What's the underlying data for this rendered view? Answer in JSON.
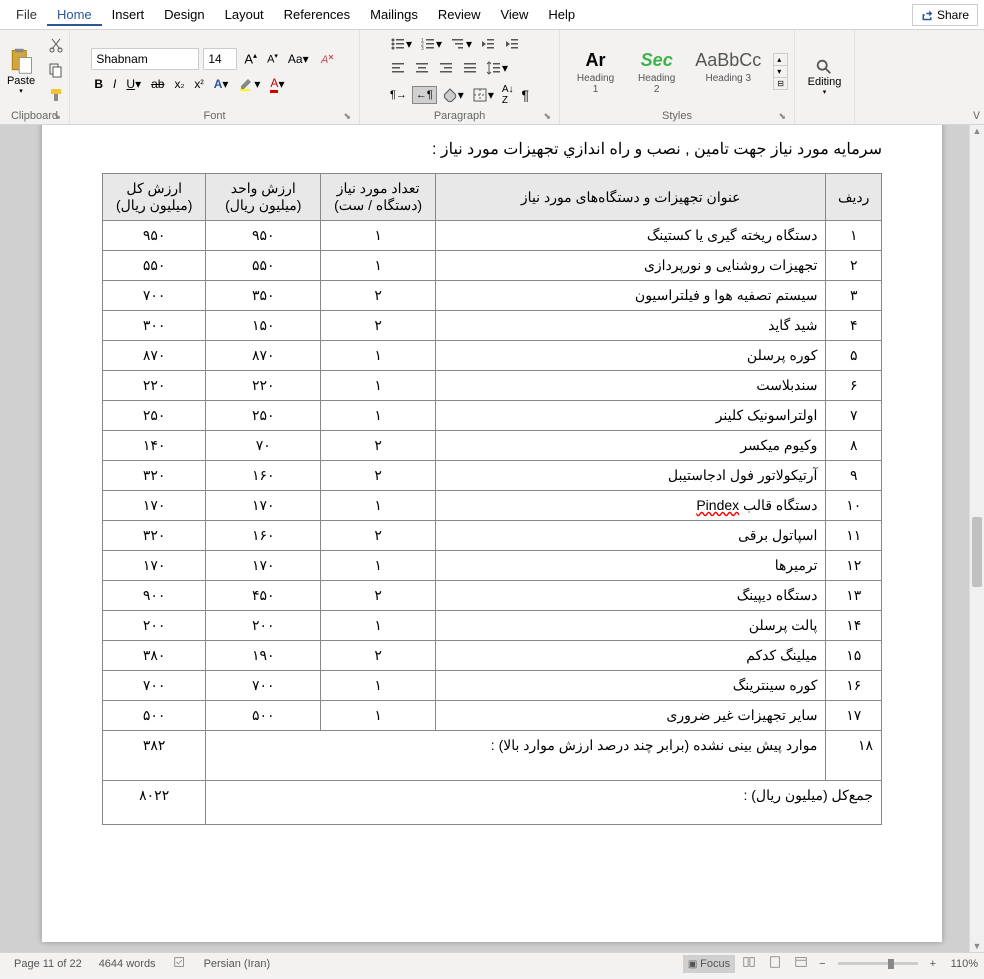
{
  "menu": {
    "file": "File",
    "home": "Home",
    "insert": "Insert",
    "design": "Design",
    "layout": "Layout",
    "references": "References",
    "mailings": "Mailings",
    "review": "Review",
    "view": "View",
    "help": "Help",
    "share": "Share"
  },
  "ribbon": {
    "clipboard": {
      "label": "Clipboard",
      "paste": "Paste"
    },
    "font": {
      "label": "Font",
      "name": "Shabnam",
      "size": "14"
    },
    "paragraph": {
      "label": "Paragraph"
    },
    "styles": {
      "label": "Styles",
      "items": [
        {
          "preview": "Ar",
          "label": "Heading 1",
          "color": "#000",
          "weight": "bold"
        },
        {
          "preview": "Sec",
          "label": "Heading 2",
          "color": "#3bb54a",
          "weight": "bold",
          "style": "italic"
        },
        {
          "preview": "AaBbCc",
          "label": "Heading 3",
          "color": "#555"
        }
      ]
    },
    "editing": {
      "label": "Editing"
    }
  },
  "document": {
    "title": "سرمایه مورد نیاز جهت تامین , نصب و راه اندازي تجهیزات مورد نیاز :",
    "headers": {
      "row": "ردیف",
      "item": "عنوان تجهیزات و دستگاه‌های مورد نیاز",
      "qty": "تعداد مورد نیاز (دستگاه / ست)",
      "unit": "ارزش واحد (میلیون ریال)",
      "total": "ارزش کل (میلیون ریال)"
    },
    "rows": [
      {
        "n": "۱",
        "item": "دستگاه ریخته گیری یا کستینگ",
        "qty": "۱",
        "unit": "۹۵۰",
        "total": "۹۵۰"
      },
      {
        "n": "۲",
        "item": "تجهیزات روشنایی و نورپردازی",
        "qty": "۱",
        "unit": "۵۵۰",
        "total": "۵۵۰"
      },
      {
        "n": "۳",
        "item": "سیستم تصفیه هوا و فیلتراسیون",
        "qty": "۲",
        "unit": "۳۵۰",
        "total": "۷۰۰"
      },
      {
        "n": "۴",
        "item": "شید گاید",
        "qty": "۲",
        "unit": "۱۵۰",
        "total": "۳۰۰"
      },
      {
        "n": "۵",
        "item": "کوره پرسلن",
        "qty": "۱",
        "unit": "۸۷۰",
        "total": "۸۷۰"
      },
      {
        "n": "۶",
        "item": "سندبلاست",
        "qty": "۱",
        "unit": "۲۲۰",
        "total": "۲۲۰"
      },
      {
        "n": "۷",
        "item": "اولتراسونیک کلینر",
        "qty": "۱",
        "unit": "۲۵۰",
        "total": "۲۵۰"
      },
      {
        "n": "۸",
        "item": "وکیوم میکسر",
        "qty": "۲",
        "unit": "۷۰",
        "total": "۱۴۰"
      },
      {
        "n": "۹",
        "item": "آرتیکولاتور فول ادجاستیبل",
        "qty": "۲",
        "unit": "۱۶۰",
        "total": "۳۲۰"
      },
      {
        "n": "۱۰",
        "item": "دستگاه قالب Pindex",
        "qty": "۱",
        "unit": "۱۷۰",
        "total": "۱۷۰"
      },
      {
        "n": "۱۱",
        "item": "اسپاتول برقی",
        "qty": "۲",
        "unit": "۱۶۰",
        "total": "۳۲۰"
      },
      {
        "n": "۱۲",
        "item": "ترمیرها",
        "qty": "۱",
        "unit": "۱۷۰",
        "total": "۱۷۰"
      },
      {
        "n": "۱۳",
        "item": "دستگاه دیپینگ",
        "qty": "۲",
        "unit": "۴۵۰",
        "total": "۹۰۰"
      },
      {
        "n": "۱۴",
        "item": "پالت پرسلن",
        "qty": "۱",
        "unit": "۲۰۰",
        "total": "۲۰۰"
      },
      {
        "n": "۱۵",
        "item": "میلینگ کدکم",
        "qty": "۲",
        "unit": "۱۹۰",
        "total": "۳۸۰"
      },
      {
        "n": "۱۶",
        "item": "کوره سینترینگ",
        "qty": "۱",
        "unit": "۷۰۰",
        "total": "۷۰۰"
      },
      {
        "n": "۱۷",
        "item": "سایر تجهیزات غیر ضروری",
        "qty": "۱",
        "unit": "۵۰۰",
        "total": "۵۰۰"
      }
    ],
    "footer_row": {
      "n": "۱۸",
      "text": "موارد پیش بینی نشده (برابر چند درصد ارزش موارد بالا) :",
      "total": "۳۸۲"
    },
    "sum_row": {
      "text": "جمع‌کل (میلیون ریال) :",
      "total": "۸۰۲۲"
    }
  },
  "status": {
    "page": "Page 11 of 22",
    "words": "4644 words",
    "language": "Persian (Iran)",
    "focus": "Focus",
    "zoom": "110%"
  }
}
